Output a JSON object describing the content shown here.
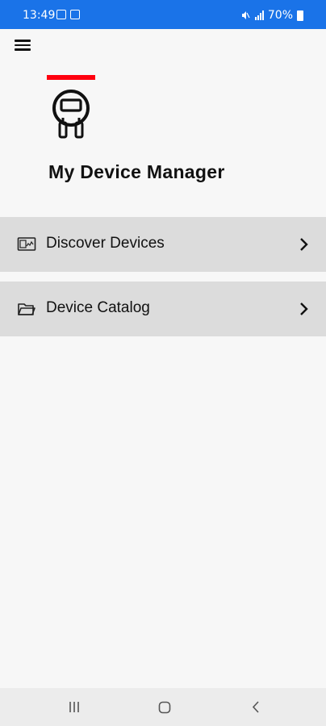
{
  "status_bar": {
    "time": "13:49",
    "battery": "70%",
    "left_icons": [
      "image-icon",
      "notification-icon"
    ],
    "right_icons": [
      "mute-icon",
      "signal-icon",
      "battery-icon"
    ]
  },
  "header": {
    "menu_icon": "hamburger-menu-icon"
  },
  "app": {
    "title": "My Device Manager",
    "logo": "device-meter-icon",
    "accent_color": "#ff000f"
  },
  "menu": {
    "items": [
      {
        "label": "Discover Devices",
        "icon": "monitor-icon"
      },
      {
        "label": "Device Catalog",
        "icon": "folder-icon"
      }
    ]
  },
  "nav_bar": {
    "buttons": [
      "recent-apps-icon",
      "home-icon",
      "back-icon"
    ]
  },
  "colors": {
    "status_bar": "#1a73e8",
    "background": "#f7f7f7",
    "menu_item_bg": "#dcdcdc"
  }
}
